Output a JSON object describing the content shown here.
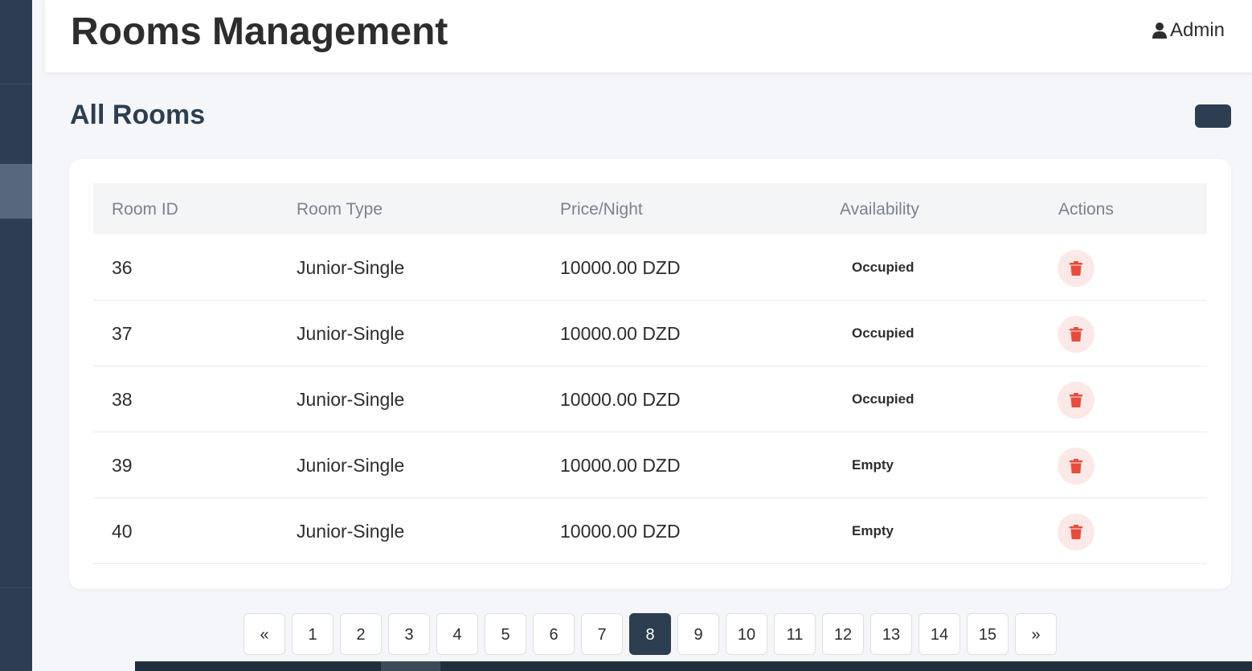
{
  "header": {
    "title": "Rooms Management",
    "user_label": "Admin"
  },
  "section": {
    "title": "All Rooms"
  },
  "table": {
    "columns": [
      "Room ID",
      "Room Type",
      "Price/Night",
      "Availability",
      "Actions"
    ],
    "rows": [
      {
        "id": "36",
        "type": "Junior-Single",
        "price": "10000.00 DZD",
        "availability": "Occupied"
      },
      {
        "id": "37",
        "type": "Junior-Single",
        "price": "10000.00 DZD",
        "availability": "Occupied"
      },
      {
        "id": "38",
        "type": "Junior-Single",
        "price": "10000.00 DZD",
        "availability": "Occupied"
      },
      {
        "id": "39",
        "type": "Junior-Single",
        "price": "10000.00 DZD",
        "availability": "Empty"
      },
      {
        "id": "40",
        "type": "Junior-Single",
        "price": "10000.00 DZD",
        "availability": "Empty"
      }
    ]
  },
  "pagination": {
    "prev": "«",
    "next": "»",
    "pages": [
      "1",
      "2",
      "3",
      "4",
      "5",
      "6",
      "7",
      "8",
      "9",
      "10",
      "11",
      "12",
      "13",
      "14",
      "15"
    ],
    "current": "8"
  },
  "colors": {
    "sidebar": "#2c3e50",
    "accent": "#2c3e50",
    "delete_icon": "#e74c3c",
    "delete_bg": "#fbe9e7"
  },
  "icons": {
    "user": "user-icon",
    "delete": "trash-icon"
  }
}
